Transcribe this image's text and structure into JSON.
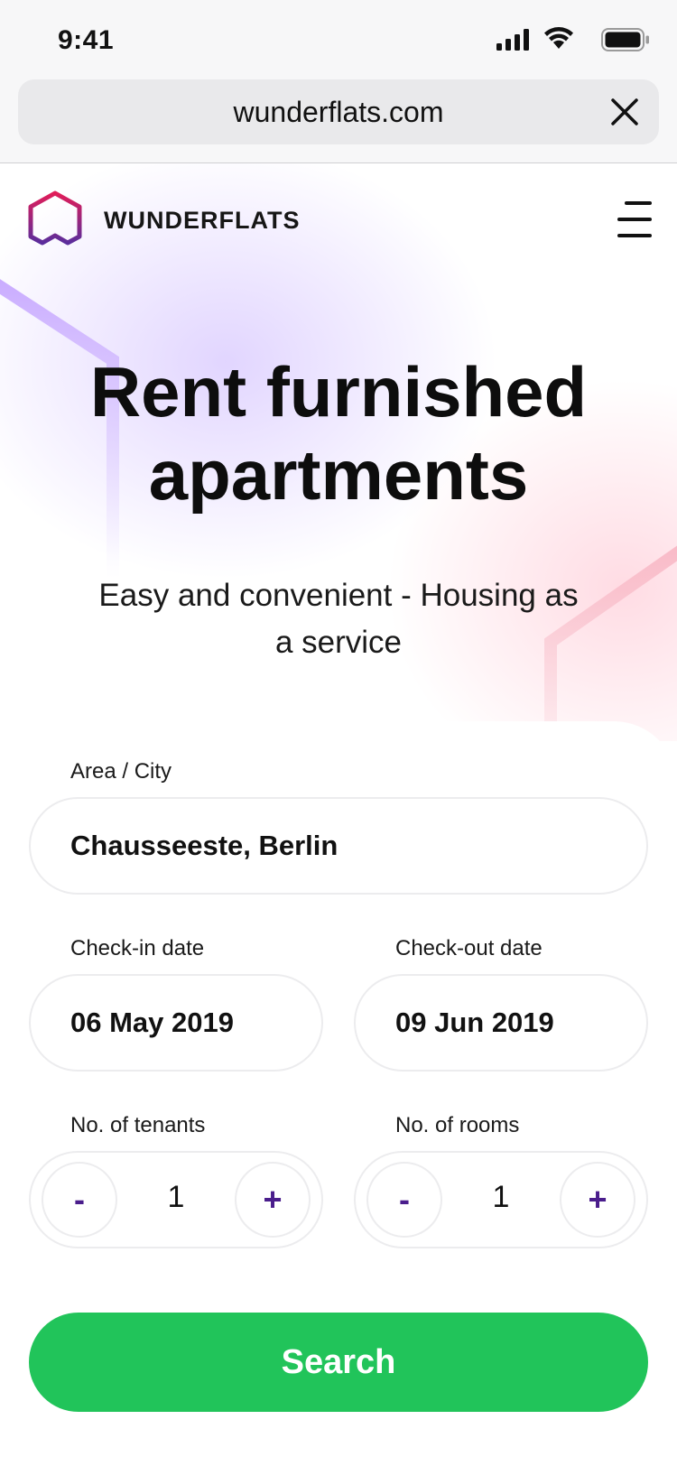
{
  "status_bar": {
    "time": "9:41"
  },
  "browser": {
    "url": "wunderflats.com"
  },
  "header": {
    "brand": "WUNDERFLATS"
  },
  "hero": {
    "title_line1": "Rent furnished",
    "title_line2": "apartments",
    "subtitle_line1": "Easy and convenient - Housing as",
    "subtitle_line2": "a service"
  },
  "search": {
    "area_label": "Area / City",
    "area_value": "Chausseeste, Berlin",
    "checkin_label": "Check-in date",
    "checkin_value": "06 May 2019",
    "checkout_label": "Check-out date",
    "checkout_value": "09 Jun 2019",
    "tenants_label": "No. of tenants",
    "tenants_value": "1",
    "rooms_label": "No. of rooms",
    "rooms_value": "1",
    "decrement_symbol": "-",
    "increment_symbol": "+",
    "button_label": "Search"
  },
  "colors": {
    "accent_green": "#21c45a",
    "stepper_purple": "#4a1d8c",
    "logo_gradient_start": "#e11d59",
    "logo_gradient_end": "#5b2d9c"
  },
  "icons": [
    "signal-icon",
    "wifi-icon",
    "battery-icon",
    "close-icon",
    "wunderflats-logo-icon",
    "hamburger-menu-icon"
  ]
}
